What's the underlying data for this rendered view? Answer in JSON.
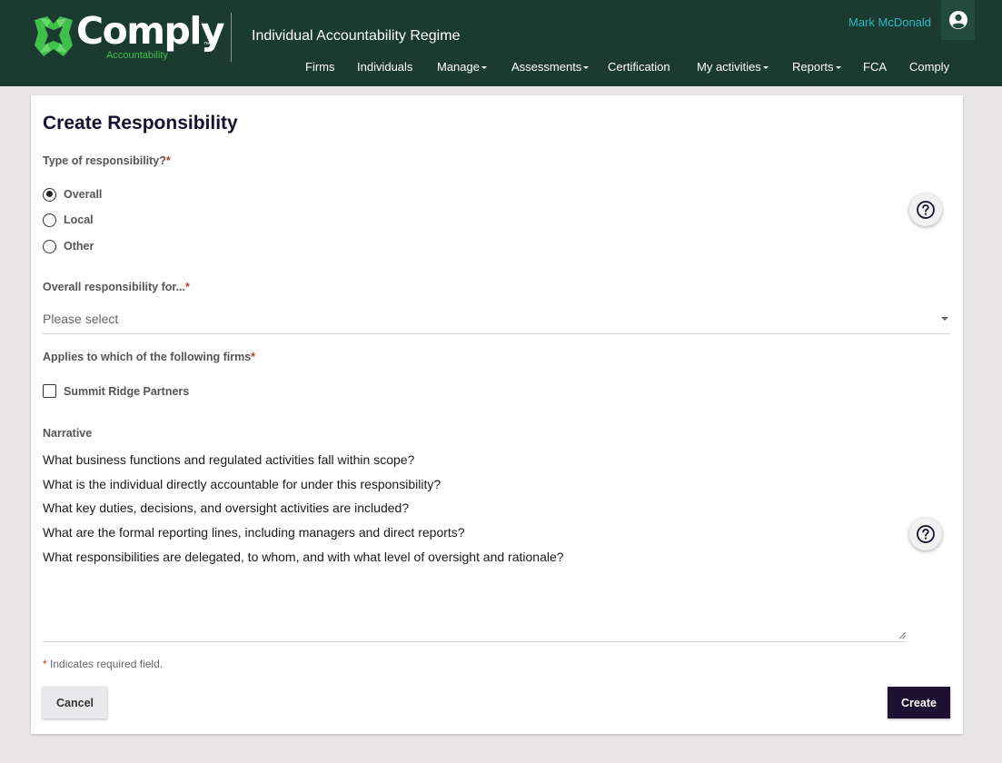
{
  "header": {
    "logo_text": "Comply",
    "logo_tm": "™",
    "logo_sub": "Accountability",
    "app_title": "Individual Accountability Regime",
    "user_name": "Mark McDonald",
    "nav": [
      {
        "label": "Firms",
        "dropdown": false
      },
      {
        "label": "Individuals",
        "dropdown": false
      },
      {
        "label": "Manage",
        "dropdown": true
      },
      {
        "label": "Assessments",
        "dropdown": true
      },
      {
        "label": "Certification",
        "dropdown": false
      },
      {
        "label": "My activities",
        "dropdown": true
      },
      {
        "label": "Reports",
        "dropdown": true
      },
      {
        "label": "FCA",
        "dropdown": false
      },
      {
        "label": "Comply",
        "dropdown": false
      }
    ]
  },
  "form": {
    "title": "Create Responsibility",
    "type_label": "Type of responsibility?",
    "required_mark": "*",
    "type_options": [
      {
        "label": "Overall",
        "checked": true
      },
      {
        "label": "Local",
        "checked": false
      },
      {
        "label": "Other",
        "checked": false
      }
    ],
    "overall_label": "Overall responsibility for...",
    "overall_value": "Please select",
    "firms_label": "Applies to which of the following firms",
    "firms": [
      {
        "label": "Summit Ridge Partners",
        "checked": false
      }
    ],
    "narrative_label": "Narrative",
    "narrative_lines": [
      "What business functions and regulated activities fall within scope?",
      "What is the individual directly accountable for under this responsibility?",
      "What key duties, decisions, and oversight activities are included?",
      "What are the formal reporting lines, including managers and direct reports?",
      "What responsibilities are delegated, to whom, and with what level of oversight and rationale?"
    ],
    "required_note": "Indicates required field.",
    "cancel_label": "Cancel",
    "create_label": "Create"
  },
  "colors": {
    "header_bg": "#1b3a30",
    "brand_green": "#3fc04a",
    "user_link": "#2ab8c9",
    "primary_button": "#1d1030",
    "required": "#c0392b"
  },
  "icons": [
    "comply-logo-icon",
    "user-circle-icon",
    "help-circle-icon",
    "dropdown-caret-icon",
    "resize-handle-icon"
  ]
}
